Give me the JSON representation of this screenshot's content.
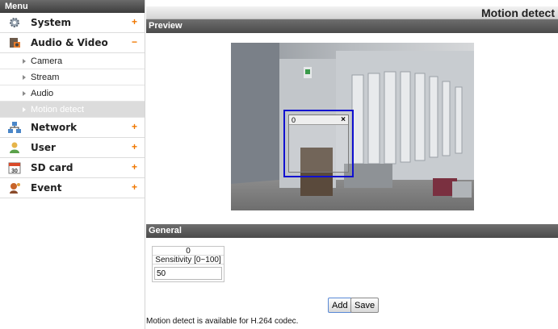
{
  "sidebar": {
    "header": "Menu",
    "items": [
      {
        "label": "System",
        "sign": "+"
      },
      {
        "label": "Audio & Video",
        "sign": "−"
      },
      {
        "label": "Network",
        "sign": "+"
      },
      {
        "label": "User",
        "sign": "+"
      },
      {
        "label": "SD card",
        "sign": "+"
      },
      {
        "label": "Event",
        "sign": "+"
      }
    ],
    "subitems": [
      {
        "label": "Camera"
      },
      {
        "label": "Stream"
      },
      {
        "label": "Audio"
      },
      {
        "label": "Motion detect"
      }
    ],
    "sd_icon_text": "30"
  },
  "page": {
    "title": "Motion detect"
  },
  "preview": {
    "section": "Preview",
    "motion_window": {
      "index": "0",
      "close": "×"
    }
  },
  "general": {
    "section": "General",
    "column_index": "0",
    "sensitivity_label": "Sensitivity [0~100]",
    "sensitivity_value": "50",
    "add_label": "Add",
    "save_label": "Save",
    "note": "Motion detect is available for H.264 codec."
  },
  "colors": {
    "accent_sign": "#f07800",
    "motion_border": "#1010d0",
    "section_bar": "#555555"
  }
}
